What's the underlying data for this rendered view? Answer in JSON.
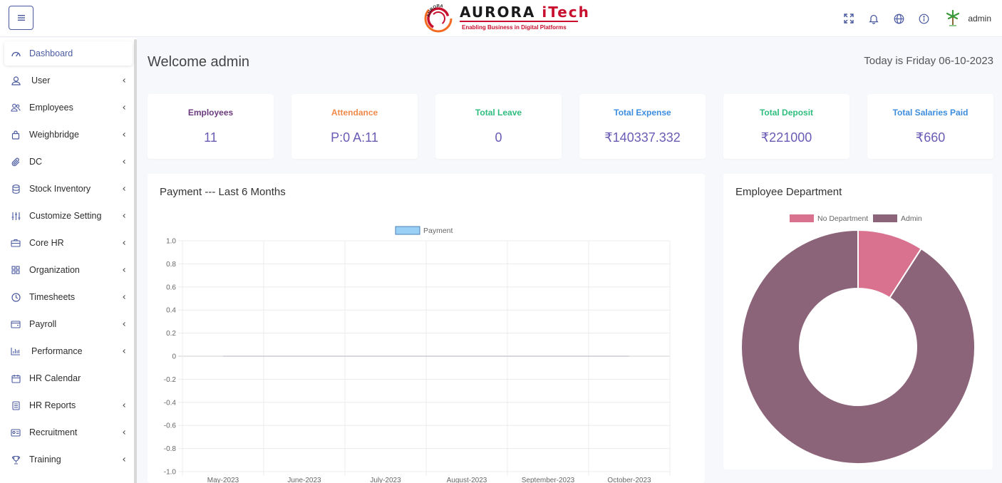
{
  "header": {
    "brand_name": "AURORA iTech",
    "brand_name_main": "AURORA ",
    "brand_name_accent": "iTech",
    "brand_ring_text": "AURORA",
    "brand_tagline": "Enabling Business in Digital Platforms",
    "user_name": "admin",
    "icons": [
      "menu-icon",
      "fullscreen-icon",
      "bell-icon",
      "globe-icon",
      "info-icon",
      "avatar"
    ]
  },
  "sidebar": {
    "items": [
      {
        "label": "Dashboard",
        "icon": "dashboard-icon",
        "active": true,
        "has_submenu": false
      },
      {
        "label": "User",
        "icon": "user-icon",
        "has_submenu": true
      },
      {
        "label": "Employees",
        "icon": "employees-icon",
        "has_submenu": true
      },
      {
        "label": "Weighbridge",
        "icon": "bag-icon",
        "has_submenu": true
      },
      {
        "label": "DC",
        "icon": "paperclip-icon",
        "has_submenu": true
      },
      {
        "label": "Stock Inventory",
        "icon": "database-icon",
        "has_submenu": true
      },
      {
        "label": "Customize Setting",
        "icon": "sliders-icon",
        "has_submenu": true
      },
      {
        "label": "Core HR",
        "icon": "briefcase-icon",
        "has_submenu": true
      },
      {
        "label": "Organization",
        "icon": "grid-icon",
        "has_submenu": true
      },
      {
        "label": "Timesheets",
        "icon": "clock-icon",
        "has_submenu": true
      },
      {
        "label": "Payroll",
        "icon": "wallet-icon",
        "has_submenu": true
      },
      {
        "label": "Performance",
        "icon": "bar-chart-icon",
        "has_submenu": true
      },
      {
        "label": "HR Calendar",
        "icon": "calendar-icon",
        "has_submenu": false
      },
      {
        "label": "HR Reports",
        "icon": "report-icon",
        "has_submenu": true
      },
      {
        "label": "Recruitment",
        "icon": "id-card-icon",
        "has_submenu": true
      },
      {
        "label": "Training",
        "icon": "trophy-icon",
        "has_submenu": true
      }
    ]
  },
  "main": {
    "welcome": "Welcome admin",
    "today": "Today is Friday 06-10-2023",
    "stats": [
      {
        "label": "Employees",
        "value": "11",
        "color": "#6b3a7d"
      },
      {
        "label": "Attendance",
        "value": "P:0 A:11",
        "color": "#f08a4b"
      },
      {
        "label": "Total Leave",
        "value": "0",
        "color": "#2ebd7e"
      },
      {
        "label": "Total Expense",
        "value": "₹140337.332",
        "color": "#3c8dde"
      },
      {
        "label": "Total Deposit",
        "value": "₹221000",
        "color": "#2ebd7e"
      },
      {
        "label": "Total Salaries Paid",
        "value": "₹660",
        "color": "#3c8dde"
      }
    ],
    "payment_panel": {
      "title": "Payment --- Last 6 Months"
    },
    "department_panel": {
      "title": "Employee Department"
    }
  },
  "chart_data": [
    {
      "type": "line",
      "title": "Payment --- Last 6 Months",
      "categories": [
        "May-2023",
        "June-2023",
        "July-2023",
        "August-2023",
        "September-2023",
        "October-2023"
      ],
      "series": [
        {
          "name": "Payment",
          "values": [
            0,
            0,
            0,
            0,
            0,
            0
          ],
          "color": "#9ad0f5"
        }
      ],
      "yticks": [
        "1.0",
        "0.8",
        "0.6",
        "0.4",
        "0.2",
        "0",
        "-0.2",
        "-0.4",
        "-0.6",
        "-0.8",
        "-1.0"
      ],
      "ylim": [
        -1,
        1
      ],
      "grid": true,
      "legend": "top"
    },
    {
      "type": "pie",
      "variant": "doughnut",
      "title": "Employee Department",
      "labels": [
        "No Department",
        "Admin"
      ],
      "values": [
        1,
        10
      ],
      "colors": [
        "#d9728f",
        "#8c6479"
      ],
      "legend": "top"
    }
  ]
}
